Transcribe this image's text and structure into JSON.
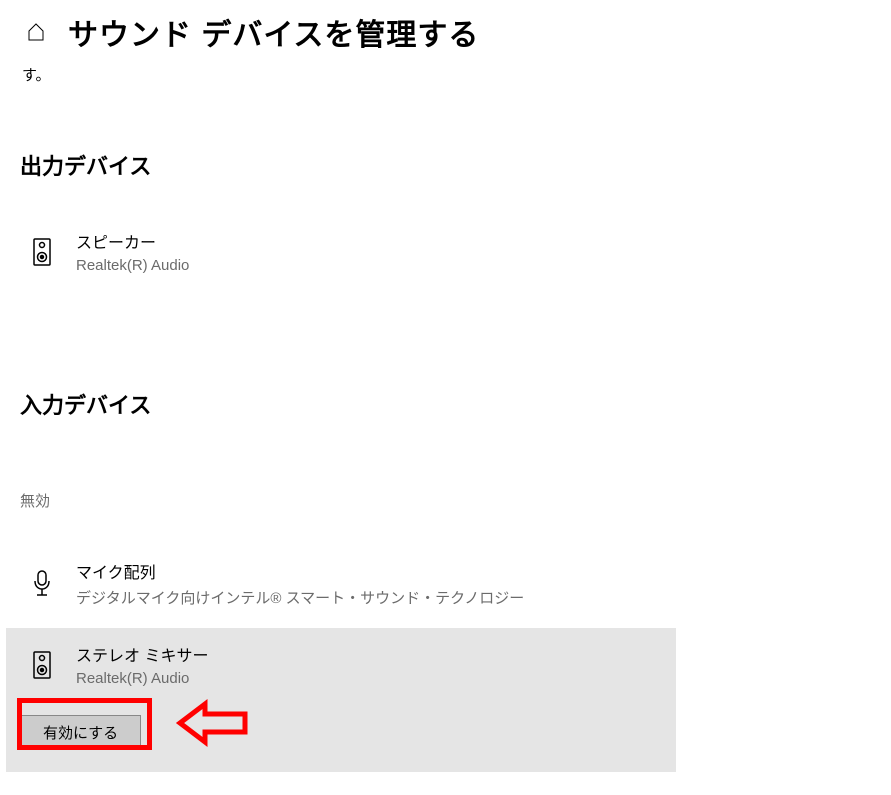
{
  "header": {
    "title": "サウンド デバイスを管理する",
    "partial_text": "す。",
    "home_icon": "home-icon"
  },
  "output_section": {
    "heading": "出力デバイス",
    "devices": [
      {
        "name": "スピーカー",
        "desc": "Realtek(R) Audio",
        "icon": "speaker-icon"
      }
    ]
  },
  "input_section": {
    "heading": "入力デバイス",
    "disabled_label": "無効",
    "devices": [
      {
        "name": "マイク配列",
        "desc": "デジタルマイク向けインテル® スマート・サウンド・テクノロジー",
        "icon": "microphone-icon"
      },
      {
        "name": "ステレオ ミキサー",
        "desc": "Realtek(R) Audio",
        "icon": "speaker-icon",
        "selected": true
      }
    ],
    "enable_button": "有効にする"
  },
  "annotation": {
    "arrow_color": "#ff0000"
  }
}
